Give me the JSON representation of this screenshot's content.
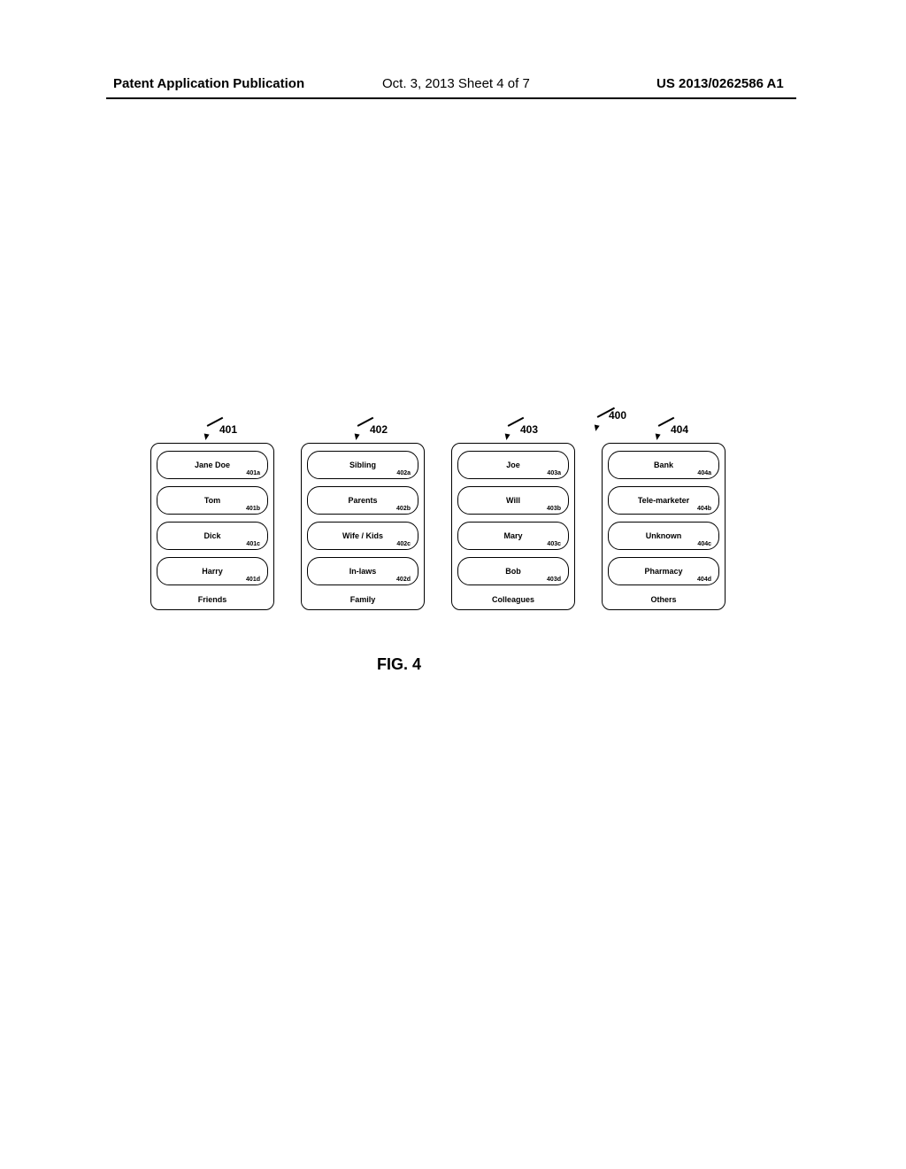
{
  "header": {
    "left": "Patent Application Publication",
    "center": "Oct. 3, 2013  Sheet 4 of 7",
    "right": "US 2013/0262586 A1"
  },
  "figure": {
    "caption": "FIG. 4",
    "overall_ref": "400",
    "groups": [
      {
        "ref": "401",
        "label": "Friends",
        "items": [
          {
            "name": "Jane Doe",
            "ref": "401a"
          },
          {
            "name": "Tom",
            "ref": "401b"
          },
          {
            "name": "Dick",
            "ref": "401c"
          },
          {
            "name": "Harry",
            "ref": "401d"
          }
        ]
      },
      {
        "ref": "402",
        "label": "Family",
        "items": [
          {
            "name": "Sibling",
            "ref": "402a"
          },
          {
            "name": "Parents",
            "ref": "402b"
          },
          {
            "name": "Wife / Kids",
            "ref": "402c"
          },
          {
            "name": "In-laws",
            "ref": "402d"
          }
        ]
      },
      {
        "ref": "403",
        "label": "Colleagues",
        "items": [
          {
            "name": "Joe",
            "ref": "403a"
          },
          {
            "name": "Will",
            "ref": "403b"
          },
          {
            "name": "Mary",
            "ref": "403c"
          },
          {
            "name": "Bob",
            "ref": "403d"
          }
        ]
      },
      {
        "ref": "404",
        "label": "Others",
        "items": [
          {
            "name": "Bank",
            "ref": "404a"
          },
          {
            "name": "Tele-marketer",
            "ref": "404b"
          },
          {
            "name": "Unknown",
            "ref": "404c"
          },
          {
            "name": "Pharmacy",
            "ref": "404d"
          }
        ]
      }
    ]
  }
}
